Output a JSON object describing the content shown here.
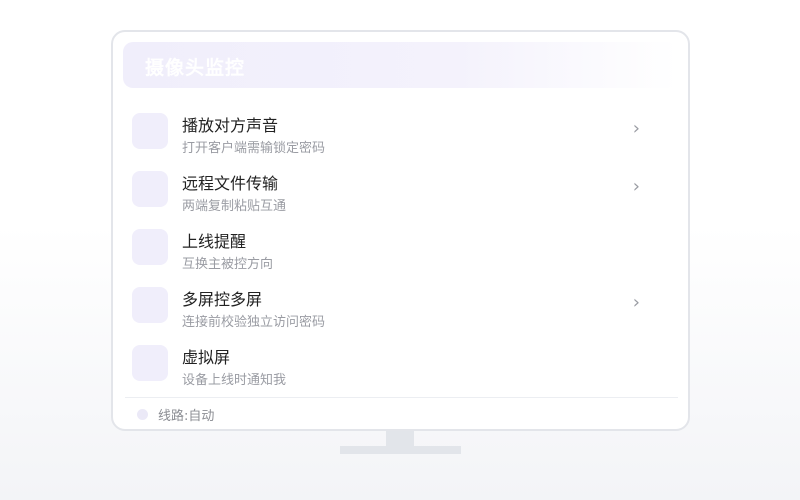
{
  "header": {
    "title": "摄像头监控"
  },
  "menu": {
    "items": [
      {
        "title": "播放对方声音",
        "subtitle": "打开客户端需输锁定密码",
        "chevron": "›"
      },
      {
        "title": "远程文件传输",
        "subtitle": "两端复制粘贴互通",
        "chevron": "›"
      },
      {
        "title": "上线提醒",
        "subtitle": "互换主被控方向",
        "chevron": ""
      },
      {
        "title": "多屏控多屏",
        "subtitle": "连接前校验独立访问密码",
        "chevron": "›"
      },
      {
        "title": "虚拟屏",
        "subtitle": "设备上线时通知我",
        "chevron": ""
      }
    ]
  },
  "footer": {
    "route_label": "线路:自动"
  },
  "colors": {
    "accent_light": "#f0eefb",
    "border": "#e3e5ea"
  }
}
